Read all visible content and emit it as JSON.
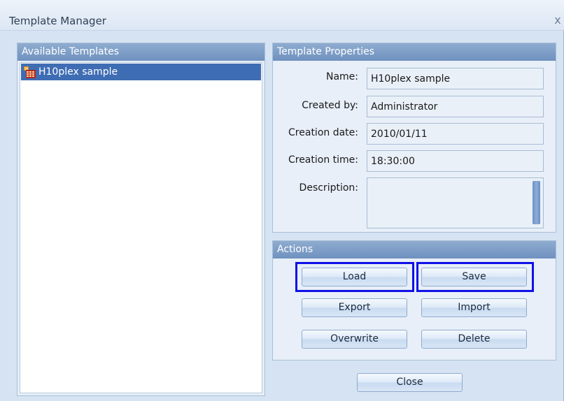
{
  "window": {
    "title": "Template Manager",
    "close_glyph": "x"
  },
  "templates_panel": {
    "header": "Available Templates",
    "items": [
      {
        "label": "H10plex sample",
        "selected": true
      }
    ]
  },
  "properties_panel": {
    "header": "Template Properties",
    "name_label": "Name:",
    "name_value": "H10plex sample",
    "created_by_label": "Created by:",
    "created_by_value": "Administrator",
    "creation_date_label": "Creation date:",
    "creation_date_value": "2010/01/11",
    "creation_time_label": "Creation time:",
    "creation_time_value": "18:30:00",
    "description_label": "Description:",
    "description_value": ""
  },
  "actions_panel": {
    "header": "Actions",
    "load_label": "Load",
    "save_label": "Save",
    "export_label": "Export",
    "import_label": "Import",
    "overwrite_label": "Overwrite",
    "delete_label": "Delete"
  },
  "footer": {
    "close_label": "Close"
  },
  "colors": {
    "panel_header": "#7a98c6",
    "selection": "#3f6db4",
    "highlight_box": "#1010e8"
  },
  "icons": {
    "template_item": "template-grid-icon",
    "close": "close-icon"
  }
}
